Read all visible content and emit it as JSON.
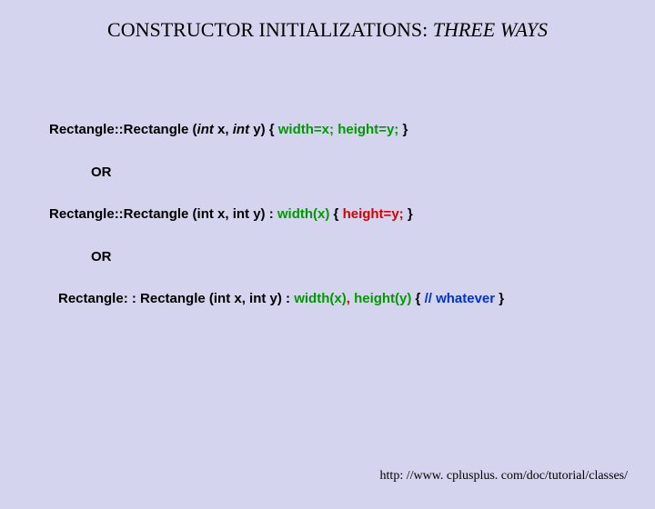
{
  "title": {
    "prefix": "CONSTRUCTOR INITIALIZATIONS: ",
    "emph": "THREE WAYS"
  },
  "code": {
    "line1": {
      "sig_a": "Rectangle::Rectangle (",
      "int1": "int",
      "x": " x, ",
      "int2": "int",
      "y_close": " y) { ",
      "w": "width=x;",
      "sp": " ",
      "h": "height=y;",
      "end": " }"
    },
    "or1": "OR",
    "line2": {
      "sig": "Rectangle::Rectangle (int x, int y) ",
      "colon": ": ",
      "wx": "width(x)",
      "brace": " { ",
      "hy": "height=y;",
      "end": " }"
    },
    "or2": "OR",
    "line3": {
      "sig": "Rectangle: : Rectangle (int x, int y) ",
      "colon": ": ",
      "wx": "width(x)",
      "comma": ", ",
      "hy": "height(y)",
      "brace": " { ",
      "cmt": "// whatever",
      "end": " }"
    }
  },
  "footer": "http: //www. cplusplus. com/doc/tutorial/classes/"
}
